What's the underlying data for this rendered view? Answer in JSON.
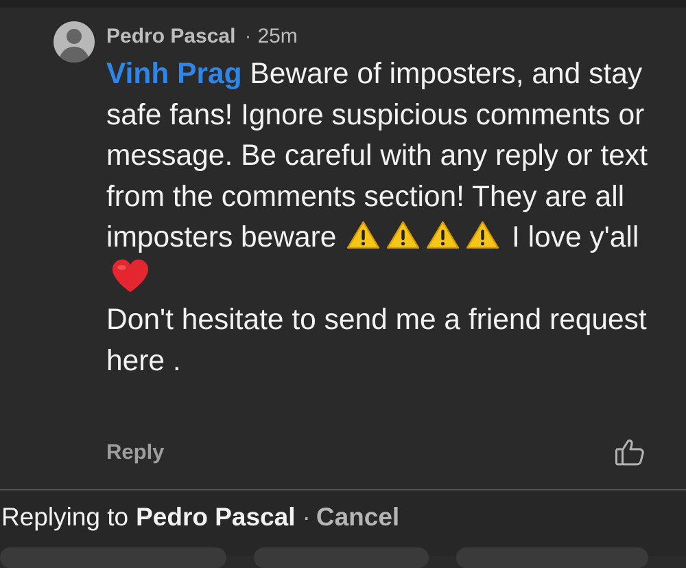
{
  "comment": {
    "author": "Pedro Pascal",
    "separator": "·",
    "time": "25m",
    "mention": "Vinh Prag",
    "text_part1": "Beware of imposters, and stay safe fans! Ignore suspicious comments or message. Be careful with any reply or text from the comments section! They are all imposters beware",
    "warning_emoji_count": 4,
    "text_part2": "I love y'all",
    "text_part3": "Don't hesitate to send me a friend request here .",
    "reply_label": "Reply"
  },
  "icons": {
    "avatar": "default-profile-avatar",
    "warning": "warning-emoji",
    "heart": "red-heart-emoji",
    "like": "thumbs-up-outline-icon"
  },
  "replying_bar": {
    "prefix": "Replying to",
    "name": "Pedro Pascal",
    "separator": "·",
    "cancel_label": "Cancel"
  },
  "colors": {
    "background": "#2a2a2a",
    "mention": "#2f86e6",
    "warning": "#f5c518",
    "heart": "#e3262f"
  }
}
